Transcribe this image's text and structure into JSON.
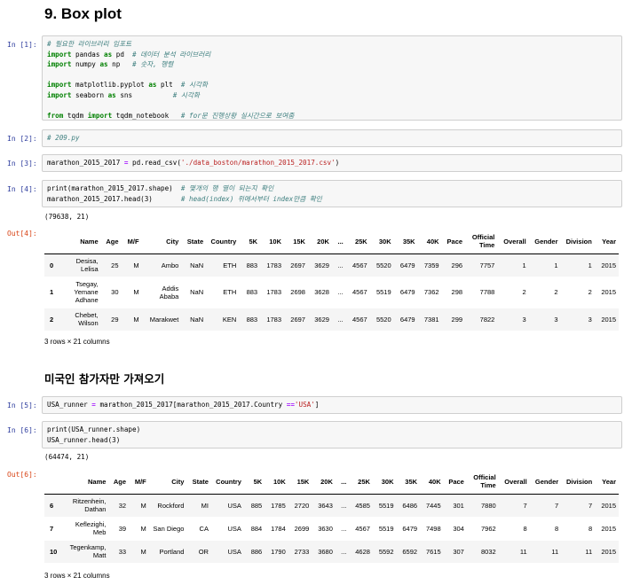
{
  "title": "9. Box plot",
  "section2_title": "미국인 참가자만 가져오기",
  "prompts": {
    "in1": "In [1]:",
    "in2": "In [2]:",
    "in3": "In [3]:",
    "in4": "In [4]:",
    "out4": "Out[4]:",
    "in5": "In [5]:",
    "in6": "In [6]:",
    "out6": "Out[6]:"
  },
  "code": {
    "c1_l1": "# 필요한 라이브러리 임포트",
    "c1_l2_kw1": "import",
    "c1_l2_a": " pandas ",
    "c1_l2_kw2": "as",
    "c1_l2_b": " pd  ",
    "c1_l2_cm": "# 데이터 분석 라이브러리",
    "c1_l3_kw1": "import",
    "c1_l3_a": " numpy ",
    "c1_l3_kw2": "as",
    "c1_l3_b": " np   ",
    "c1_l3_cm": "# 숫자, 행렬",
    "c1_l5_kw1": "import",
    "c1_l5_a": " matplotlib.pyplot ",
    "c1_l5_kw2": "as",
    "c1_l5_b": " plt  ",
    "c1_l5_cm": "# 시각화",
    "c1_l6_kw1": "import",
    "c1_l6_a": " seaborn ",
    "c1_l6_kw2": "as",
    "c1_l6_b": " sns          ",
    "c1_l6_cm": "# 시각화",
    "c1_l8_kw1": "from",
    "c1_l8_a": " tqdm ",
    "c1_l8_kw2": "import",
    "c1_l8_b": " tqdm_notebook   ",
    "c1_l8_cm": "# for문 진행상황 실시간으로 보여줌",
    "c2": "# 209.py",
    "c3_a": "marathon_2015_2017 ",
    "c3_op": "=",
    "c3_b": " pd.read_csv(",
    "c3_str": "'./data_boston/marathon_2015_2017.csv'",
    "c3_c": ")",
    "c4_l1_a": "print(marathon_2015_2017.shape)  ",
    "c4_l1_cm": "# 몇개의 행 열이 되는지 확인",
    "c4_l2_a": "marathon_2015_2017.head(3)       ",
    "c4_l2_cm": "# head(index) 위에서부터 index만큼 확인",
    "c5_a": "USA_runner ",
    "c5_op1": "=",
    "c5_b": " marathon_2015_2017[marathon_2015_2017.Country ",
    "c5_op2": "==",
    "c5_str": "'USA'",
    "c5_c": "]",
    "c6_l1": "print(USA_runner.shape)",
    "c6_l2": "USA_runner.head(3)"
  },
  "out4_shape": "(79638, 21)",
  "out6_shape": "(64474, 21)",
  "rows_note": "3 rows × 21 columns",
  "columns": [
    "",
    "Name",
    "Age",
    "M/F",
    "City",
    "State",
    "Country",
    "5K",
    "10K",
    "15K",
    "20K",
    "...",
    "25K",
    "30K",
    "35K",
    "40K",
    "Pace",
    "Official Time",
    "Overall",
    "Gender",
    "Division",
    "Year"
  ],
  "table1": [
    [
      "0",
      "Desisa, Lelisa",
      "25",
      "M",
      "Ambo",
      "NaN",
      "ETH",
      "883",
      "1783",
      "2697",
      "3629",
      "...",
      "4567",
      "5520",
      "6479",
      "7359",
      "296",
      "7757",
      "1",
      "1",
      "1",
      "2015"
    ],
    [
      "1",
      "Tsegay, Yemane Adhane",
      "30",
      "M",
      "Addis Ababa",
      "NaN",
      "ETH",
      "883",
      "1783",
      "2698",
      "3628",
      "...",
      "4567",
      "5519",
      "6479",
      "7362",
      "298",
      "7788",
      "2",
      "2",
      "2",
      "2015"
    ],
    [
      "2",
      "Chebet, Wilson",
      "29",
      "M",
      "Marakwet",
      "NaN",
      "KEN",
      "883",
      "1783",
      "2697",
      "3629",
      "...",
      "4567",
      "5520",
      "6479",
      "7381",
      "299",
      "7822",
      "3",
      "3",
      "3",
      "2015"
    ]
  ],
  "table2": [
    [
      "6",
      "Ritzenhein, Dathan",
      "32",
      "M",
      "Rockford",
      "MI",
      "USA",
      "885",
      "1785",
      "2720",
      "3643",
      "...",
      "4585",
      "5519",
      "6486",
      "7445",
      "301",
      "7880",
      "7",
      "7",
      "7",
      "2015"
    ],
    [
      "7",
      "Keflezighi, Meb",
      "39",
      "M",
      "San Diego",
      "CA",
      "USA",
      "884",
      "1784",
      "2699",
      "3630",
      "...",
      "4567",
      "5519",
      "6479",
      "7498",
      "304",
      "7962",
      "8",
      "8",
      "8",
      "2015"
    ],
    [
      "10",
      "Tegenkamp, Matt",
      "33",
      "M",
      "Portland",
      "OR",
      "USA",
      "886",
      "1790",
      "2733",
      "3680",
      "...",
      "4628",
      "5592",
      "6592",
      "7615",
      "307",
      "8032",
      "11",
      "11",
      "11",
      "2015"
    ]
  ]
}
